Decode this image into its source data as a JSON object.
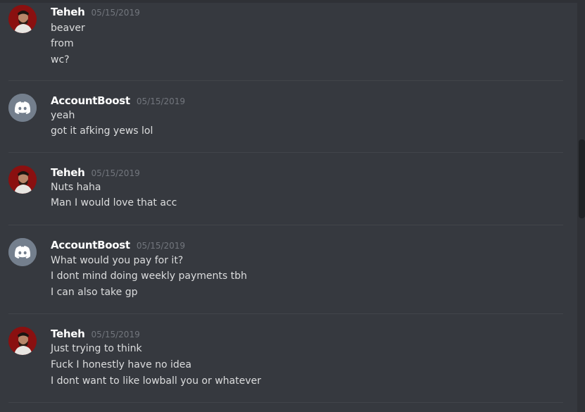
{
  "colors": {
    "background": "#36393f",
    "username": "#ffffff",
    "timestamp": "#72767d",
    "text": "#dcddde",
    "divider": "#42454a"
  },
  "messages": [
    {
      "author": "Teheh",
      "avatar": "user-photo-icon",
      "timestamp": "05/15/2019",
      "lines": [
        "beaver",
        "from",
        "wc?"
      ]
    },
    {
      "author": "AccountBoost",
      "avatar": "discord-logo-icon",
      "timestamp": "05/15/2019",
      "lines": [
        "yeah",
        "got it afking yews lol"
      ]
    },
    {
      "author": "Teheh",
      "avatar": "user-photo-icon",
      "timestamp": "05/15/2019",
      "lines": [
        "Nuts haha",
        "Man I would love that acc"
      ]
    },
    {
      "author": "AccountBoost",
      "avatar": "discord-logo-icon",
      "timestamp": "05/15/2019",
      "lines": [
        "What would you pay for it?",
        "I dont mind doing weekly payments tbh",
        "I can also take gp"
      ]
    },
    {
      "author": "Teheh",
      "avatar": "user-photo-icon",
      "timestamp": "05/15/2019",
      "lines": [
        "Just trying to think",
        "Fuck I honestly have no idea",
        "I dont want to like lowball you or whatever"
      ]
    }
  ]
}
